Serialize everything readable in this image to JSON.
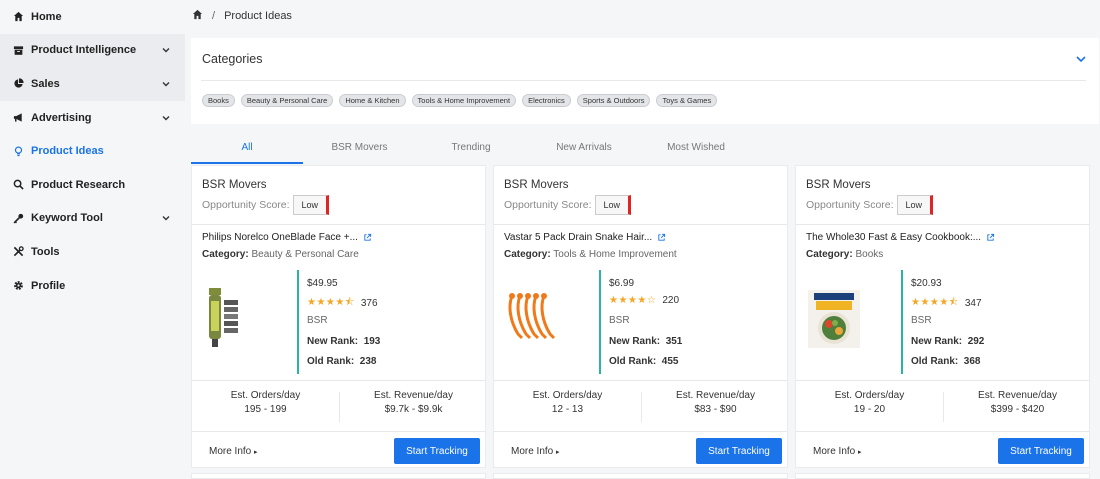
{
  "sidebar": {
    "items": [
      {
        "label": "Home",
        "icon": "home-icon"
      },
      {
        "label": "Product Intelligence",
        "icon": "archive-icon"
      },
      {
        "label": "Sales",
        "icon": "chart-pie-icon"
      },
      {
        "label": "Advertising",
        "icon": "bullhorn-icon"
      },
      {
        "label": "Product Ideas",
        "icon": "lightbulb-icon"
      },
      {
        "label": "Product Research",
        "icon": "search-icon"
      },
      {
        "label": "Keyword Tool",
        "icon": "key-icon"
      },
      {
        "label": "Tools",
        "icon": "tools-icon"
      },
      {
        "label": "Profile",
        "icon": "gear-icon"
      }
    ],
    "active_color": "#1a73e8"
  },
  "breadcrumb": {
    "separator": "/",
    "current": "Product Ideas"
  },
  "categories": {
    "title": "Categories",
    "chips": [
      "Books",
      "Beauty & Personal Care",
      "Home & Kitchen",
      "Tools & Home Improvement",
      "Electronics",
      "Sports & Outdoors",
      "Toys & Games"
    ]
  },
  "tabs": [
    "All",
    "BSR Movers",
    "Trending",
    "New Arrivals",
    "Most Wished"
  ],
  "cards": [
    {
      "type": "BSR Movers",
      "opportunity_label": "Opportunity Score:",
      "opportunity_value": "Low",
      "product_name": "Philips Norelco OneBlade Face +...",
      "category_label": "Category:",
      "category": "Beauty & Personal Care",
      "price": "$49.95",
      "stars": "★★★★⯪",
      "rating": 4.5,
      "reviews": "376",
      "bsr_label": "BSR",
      "new_rank_label": "New Rank:",
      "new_rank": "193",
      "old_rank_label": "Old Rank:",
      "old_rank": "238",
      "orders_label": "Est. Orders/day",
      "orders": "195 - 199",
      "revenue_label": "Est. Revenue/day",
      "revenue": "$9.7k - $9.9k",
      "more_info": "More Info",
      "track_label": "Start Tracking"
    },
    {
      "type": "BSR Movers",
      "opportunity_label": "Opportunity Score:",
      "opportunity_value": "Low",
      "product_name": "Vastar 5 Pack Drain Snake Hair...",
      "category_label": "Category:",
      "category": "Tools & Home Improvement",
      "price": "$6.99",
      "stars": "★★★★☆",
      "rating": 4,
      "reviews": "220",
      "bsr_label": "BSR",
      "new_rank_label": "New Rank:",
      "new_rank": "351",
      "old_rank_label": "Old Rank:",
      "old_rank": "455",
      "orders_label": "Est. Orders/day",
      "orders": "12 - 13",
      "revenue_label": "Est. Revenue/day",
      "revenue": "$83 - $90",
      "more_info": "More Info",
      "track_label": "Start Tracking"
    },
    {
      "type": "BSR Movers",
      "opportunity_label": "Opportunity Score:",
      "opportunity_value": "Low",
      "product_name": "The Whole30 Fast & Easy Cookbook:...",
      "category_label": "Category:",
      "category": "Books",
      "price": "$20.93",
      "stars": "★★★★⯪",
      "rating": 4.5,
      "reviews": "347",
      "bsr_label": "BSR",
      "new_rank_label": "New Rank:",
      "new_rank": "292",
      "old_rank_label": "Old Rank:",
      "old_rank": "368",
      "orders_label": "Est. Orders/day",
      "orders": "19 - 20",
      "revenue_label": "Est. Revenue/day",
      "revenue": "$399 - $420",
      "more_info": "More Info",
      "track_label": "Start Tracking"
    }
  ]
}
